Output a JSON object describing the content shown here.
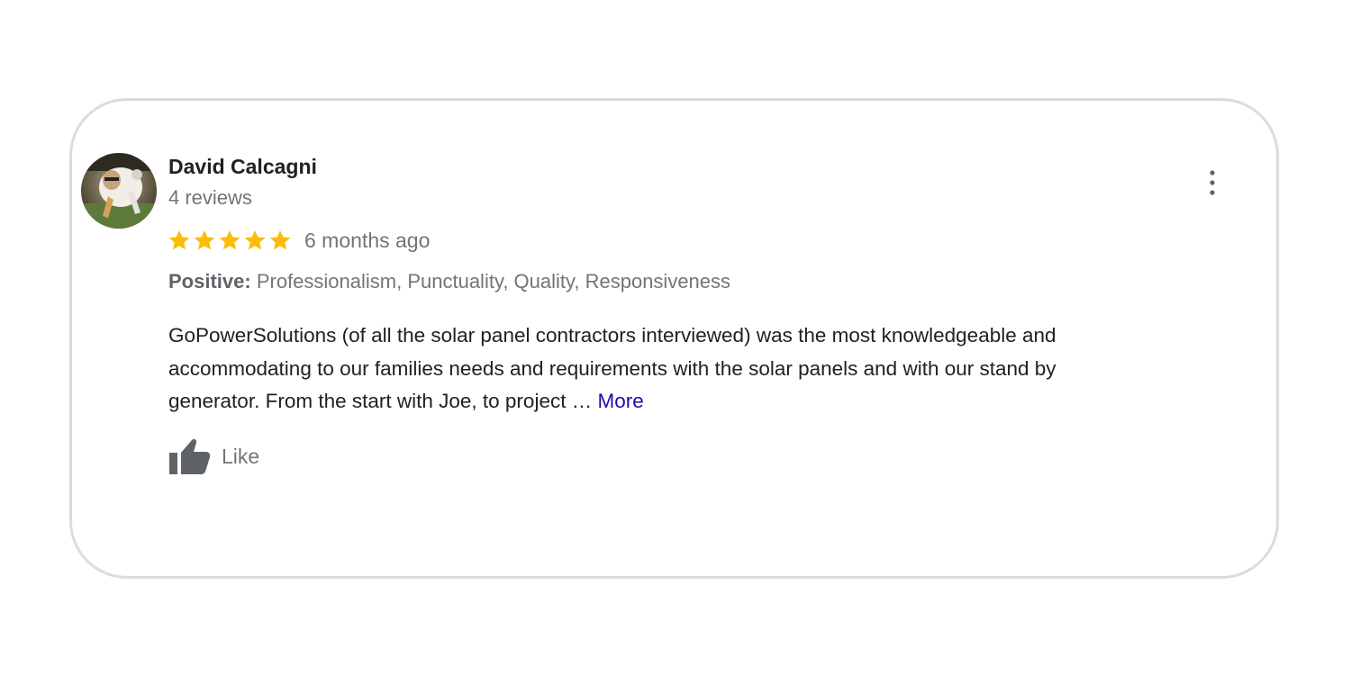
{
  "reviewer": {
    "name": "David Calcagni",
    "review_count": "4 reviews",
    "avatar_icon": "reviewer-avatar"
  },
  "rating": {
    "stars": 5,
    "max_stars": 5,
    "star_color": "#fbbc04",
    "time_ago": "6 months ago"
  },
  "positive": {
    "label": "Positive:",
    "items": "Professionalism, Punctuality, Quality, Responsiveness"
  },
  "review": {
    "lines": [
      "GoPowerSolutions (of all the solar panel contractors interviewed) was the most knowledgeable and",
      "accommodating to our families needs and requirements with the solar panels and with our stand by",
      "generator. From the start with Joe, to project … "
    ],
    "more_label": "More",
    "link_color": "#1a0dab"
  },
  "actions": {
    "like_label": "Like",
    "like_icon": "thumbs-up-icon",
    "menu_icon": "more-vert-icon"
  }
}
